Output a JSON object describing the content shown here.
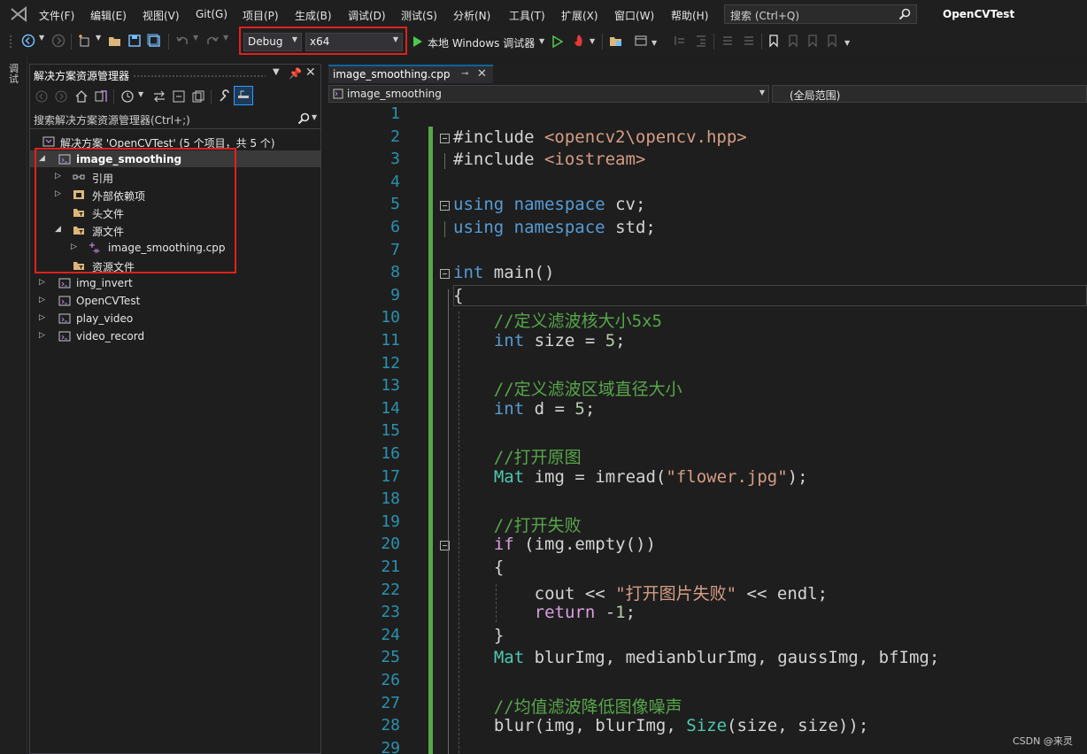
{
  "menubar": {
    "items": [
      "文件(F)",
      "编辑(E)",
      "视图(V)",
      "Git(G)",
      "项目(P)",
      "生成(B)",
      "调试(D)",
      "测试(S)",
      "分析(N)",
      "工具(T)",
      "扩展(X)",
      "窗口(W)",
      "帮助(H)"
    ],
    "search_placeholder": "搜索 (Ctrl+Q)",
    "app_title": "OpenCVTest"
  },
  "toolbar": {
    "configuration": "Debug",
    "platform": "x64",
    "run_label": "本地 Windows 调试器"
  },
  "left_strip": {
    "label": "调\n试"
  },
  "solution_explorer": {
    "title": "解决方案资源管理器",
    "search_placeholder": "搜索解决方案资源管理器(Ctrl+;)",
    "solution_label": "解决方案 'OpenCVTest' (5 个项目，共 5 个)",
    "selected_project": "image_smoothing",
    "children": [
      "引用",
      "外部依赖项",
      "头文件",
      "源文件",
      "image_smoothing.cpp",
      "资源文件"
    ],
    "other_projects": [
      "img_invert",
      "OpenCVTest",
      "play_video",
      "video_record"
    ]
  },
  "editor": {
    "tab_title": "image_smoothing.cpp",
    "nav_scope": "image_smoothing",
    "nav_member": "(全局范围)",
    "lines": [
      {
        "n": "1",
        "t": ""
      },
      {
        "n": "2",
        "t": "#include <opencv2\\opencv.hpp>"
      },
      {
        "n": "3",
        "t": "#include <iostream>"
      },
      {
        "n": "4",
        "t": ""
      },
      {
        "n": "5",
        "t": "using namespace cv;"
      },
      {
        "n": "6",
        "t": "using namespace std;"
      },
      {
        "n": "7",
        "t": ""
      },
      {
        "n": "8",
        "t": "int main()"
      },
      {
        "n": "9",
        "t": "{"
      },
      {
        "n": "10",
        "t": "    //定义滤波核大小5x5"
      },
      {
        "n": "11",
        "t": "    int size = 5;"
      },
      {
        "n": "12",
        "t": ""
      },
      {
        "n": "13",
        "t": "    //定义滤波区域直径大小"
      },
      {
        "n": "14",
        "t": "    int d = 5;"
      },
      {
        "n": "15",
        "t": ""
      },
      {
        "n": "16",
        "t": "    //打开原图"
      },
      {
        "n": "17",
        "t": "    Mat img = imread(\"flower.jpg\");"
      },
      {
        "n": "18",
        "t": ""
      },
      {
        "n": "19",
        "t": "    //打开失败"
      },
      {
        "n": "20",
        "t": "    if (img.empty())"
      },
      {
        "n": "21",
        "t": "    {"
      },
      {
        "n": "22",
        "t": "        cout << \"打开图片失败\" << endl;"
      },
      {
        "n": "23",
        "t": "        return -1;"
      },
      {
        "n": "24",
        "t": "    }"
      },
      {
        "n": "25",
        "t": "    Mat blurImg, medianblurImg, gaussImg, bfImg;"
      },
      {
        "n": "26",
        "t": ""
      },
      {
        "n": "27",
        "t": "    //均值滤波降低图像噪声"
      },
      {
        "n": "28",
        "t": "    blur(img, blurImg, Size(size, size));"
      },
      {
        "n": "29",
        "t": ""
      }
    ]
  },
  "watermark": "CSDN @来灵",
  "colors": {
    "highlight": "#e0211d",
    "keyword": "#569cd6",
    "comment": "#57a64a",
    "string": "#d69d85",
    "type": "#4ec9b0"
  }
}
